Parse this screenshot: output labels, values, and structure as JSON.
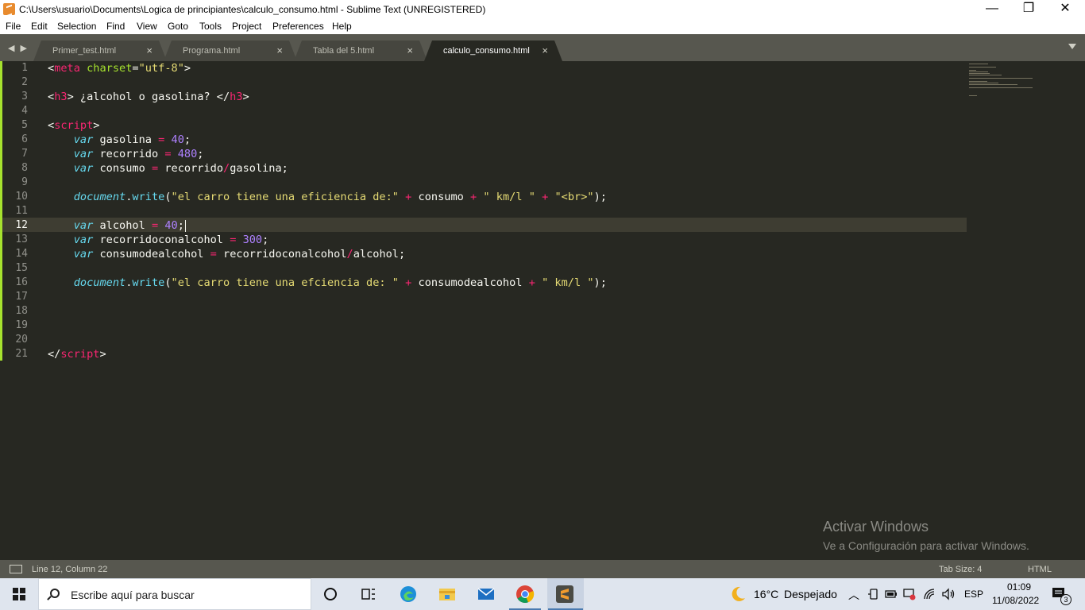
{
  "window": {
    "title": "C:\\Users\\usuario\\Documents\\Logica de principiantes\\calculo_consumo.html - Sublime Text (UNREGISTERED)",
    "minimize": "—",
    "maximize": "❐",
    "close": "✕"
  },
  "menu": [
    "File",
    "Edit",
    "Selection",
    "Find",
    "View",
    "Goto",
    "Tools",
    "Project",
    "Preferences",
    "Help"
  ],
  "tabs": [
    {
      "label": "Primer_test.html",
      "active": false
    },
    {
      "label": "Programa.html",
      "active": false
    },
    {
      "label": "Tabla del 5.html",
      "active": false
    },
    {
      "label": "calculo_consumo.html",
      "active": true
    }
  ],
  "tab_close_glyph": "×",
  "nav_arrows": "◀ ▶",
  "line_numbers": [
    "1",
    "2",
    "3",
    "4",
    "5",
    "6",
    "7",
    "8",
    "9",
    "10",
    "11",
    "12",
    "13",
    "14",
    "15",
    "16",
    "17",
    "18",
    "19",
    "20",
    "21"
  ],
  "current_line": "12",
  "code_lines": [
    [
      [
        "<",
        "p"
      ],
      [
        "meta",
        "tag"
      ],
      [
        " ",
        "p"
      ],
      [
        "charset",
        "attr"
      ],
      [
        "=",
        "p"
      ],
      [
        "\"utf-8\"",
        "str"
      ],
      [
        ">",
        "p"
      ]
    ],
    [],
    [
      [
        "<",
        "p"
      ],
      [
        "h3",
        "tag"
      ],
      [
        "> ¿alcohol o gasolina? </",
        "p"
      ],
      [
        "h3",
        "tag"
      ],
      [
        ">",
        "p"
      ]
    ],
    [],
    [
      [
        "<",
        "p"
      ],
      [
        "script",
        "tag"
      ],
      [
        ">",
        "p"
      ]
    ],
    [
      [
        "    ",
        "p"
      ],
      [
        "var",
        "kw"
      ],
      [
        " gasolina ",
        "p"
      ],
      [
        "=",
        "op"
      ],
      [
        " ",
        "p"
      ],
      [
        "40",
        "num"
      ],
      [
        ";",
        "p"
      ]
    ],
    [
      [
        "    ",
        "p"
      ],
      [
        "var",
        "kw"
      ],
      [
        " recorrido ",
        "p"
      ],
      [
        "=",
        "op"
      ],
      [
        " ",
        "p"
      ],
      [
        "480",
        "num"
      ],
      [
        ";",
        "p"
      ]
    ],
    [
      [
        "    ",
        "p"
      ],
      [
        "var",
        "kw"
      ],
      [
        " consumo ",
        "p"
      ],
      [
        "=",
        "op"
      ],
      [
        " recorrido",
        "p"
      ],
      [
        "/",
        "op"
      ],
      [
        "gasolina;",
        "p"
      ]
    ],
    [],
    [
      [
        "    ",
        "p"
      ],
      [
        "document",
        "kw"
      ],
      [
        ".",
        "p"
      ],
      [
        "write",
        "fn"
      ],
      [
        "(",
        "p"
      ],
      [
        "\"el carro tiene una eficiencia de:\"",
        "str"
      ],
      [
        " ",
        "p"
      ],
      [
        "+",
        "op"
      ],
      [
        " consumo ",
        "p"
      ],
      [
        "+",
        "op"
      ],
      [
        " ",
        "p"
      ],
      [
        "\" km/l \"",
        "str"
      ],
      [
        " ",
        "p"
      ],
      [
        "+",
        "op"
      ],
      [
        " ",
        "p"
      ],
      [
        "\"<br>\"",
        "str"
      ],
      [
        ");",
        "p"
      ]
    ],
    [],
    [
      [
        "    ",
        "p"
      ],
      [
        "var",
        "kw"
      ],
      [
        " alcohol ",
        "p"
      ],
      [
        "=",
        "op"
      ],
      [
        " ",
        "p"
      ],
      [
        "40",
        "num"
      ],
      [
        ";",
        "p"
      ]
    ],
    [
      [
        "    ",
        "p"
      ],
      [
        "var",
        "kw"
      ],
      [
        " recorridoconalcohol ",
        "p"
      ],
      [
        "=",
        "op"
      ],
      [
        " ",
        "p"
      ],
      [
        "300",
        "num"
      ],
      [
        ";",
        "p"
      ]
    ],
    [
      [
        "    ",
        "p"
      ],
      [
        "var",
        "kw"
      ],
      [
        " consumodealcohol ",
        "p"
      ],
      [
        "=",
        "op"
      ],
      [
        " recorridoconalcohol",
        "p"
      ],
      [
        "/",
        "op"
      ],
      [
        "alcohol;",
        "p"
      ]
    ],
    [],
    [
      [
        "    ",
        "p"
      ],
      [
        "document",
        "kw"
      ],
      [
        ".",
        "p"
      ],
      [
        "write",
        "fn"
      ],
      [
        "(",
        "p"
      ],
      [
        "\"el carro tiene una efciencia de: \"",
        "str"
      ],
      [
        " ",
        "p"
      ],
      [
        "+",
        "op"
      ],
      [
        " consumodealcohol ",
        "p"
      ],
      [
        "+",
        "op"
      ],
      [
        " ",
        "p"
      ],
      [
        "\" km/l \"",
        "str"
      ],
      [
        ");",
        "p"
      ]
    ],
    [],
    [],
    [],
    [],
    [
      [
        "</",
        "p"
      ],
      [
        "script",
        "tag"
      ],
      [
        ">",
        "p"
      ]
    ]
  ],
  "watermark": {
    "line1": "Activar Windows",
    "line2": "Ve a Configuración para activar Windows."
  },
  "status": {
    "position": "Line 12, Column 22",
    "tab_size": "Tab Size: 4",
    "syntax": "HTML"
  },
  "taskbar": {
    "search_placeholder": "Escribe aquí para buscar",
    "apps": [
      "cortana-icon",
      "task-view-icon",
      "edge-icon",
      "file-explorer-icon",
      "mail-icon",
      "chrome-icon",
      "sublime-text-icon"
    ],
    "weather_temp": "16°C",
    "weather_text": "Despejado",
    "language": "ESP",
    "time": "01:09",
    "date": "11/08/2022",
    "notification_count": "3"
  },
  "colors": {
    "editor_bg": "#272822",
    "tag": "#f92672",
    "attr": "#a6e22e",
    "string": "#e6db74",
    "number": "#ae81ff",
    "keyword": "#66d9ef",
    "text": "#f8f8f2"
  }
}
